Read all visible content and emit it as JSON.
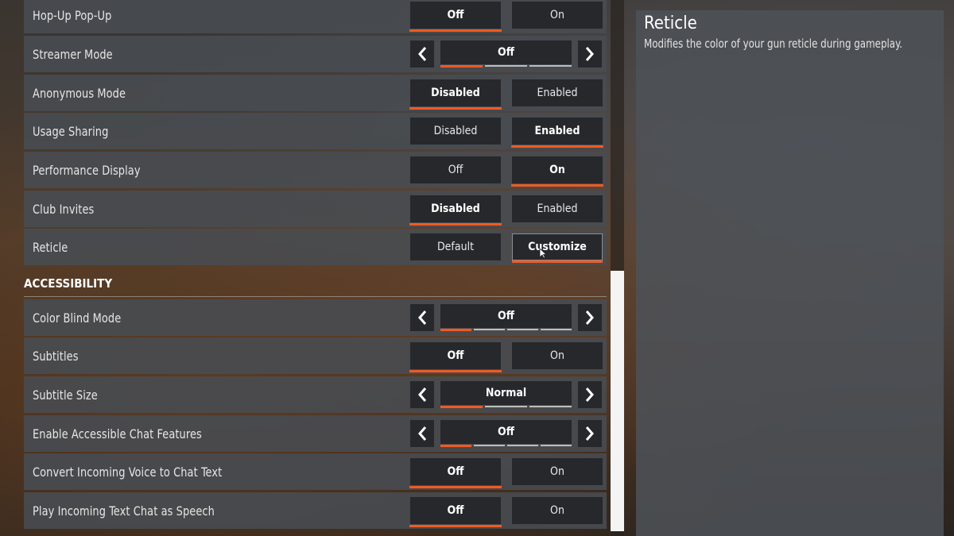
{
  "colors": {
    "accent": "#f05a22",
    "scrollbar": "#f4f4f4"
  },
  "rows_top": [
    {
      "label": "Hop-Up Pop-Up",
      "type": "toggle",
      "options": [
        "Off",
        "On"
      ],
      "selected": 0
    },
    {
      "label": "Streamer Mode",
      "type": "carousel",
      "value": "Off",
      "pips": 3,
      "index": 0
    },
    {
      "label": "Anonymous Mode",
      "type": "toggle",
      "options": [
        "Disabled",
        "Enabled"
      ],
      "selected": 0
    },
    {
      "label": "Usage Sharing",
      "type": "toggle",
      "options": [
        "Disabled",
        "Enabled"
      ],
      "selected": 1
    },
    {
      "label": "Performance Display",
      "type": "toggle",
      "options": [
        "Off",
        "On"
      ],
      "selected": 1
    },
    {
      "label": "Club Invites",
      "type": "toggle",
      "options": [
        "Disabled",
        "Enabled"
      ],
      "selected": 0
    },
    {
      "label": "Reticle",
      "type": "toggle",
      "options": [
        "Default",
        "Customize"
      ],
      "selected": 1,
      "hovered": 1
    }
  ],
  "section": {
    "title": "ACCESSIBILITY"
  },
  "rows_access": [
    {
      "label": "Color Blind Mode",
      "type": "carousel",
      "value": "Off",
      "pips": 4,
      "index": 0
    },
    {
      "label": "Subtitles",
      "type": "toggle",
      "options": [
        "Off",
        "On"
      ],
      "selected": 0
    },
    {
      "label": "Subtitle Size",
      "type": "carousel",
      "value": "Normal",
      "pips": 3,
      "index": 0
    },
    {
      "label": "Enable Accessible Chat Features",
      "type": "carousel",
      "value": "Off",
      "pips": 4,
      "index": 0
    },
    {
      "label": "Convert Incoming Voice to Chat Text",
      "type": "toggle",
      "options": [
        "Off",
        "On"
      ],
      "selected": 0
    },
    {
      "label": "Play Incoming Text Chat as Speech",
      "type": "toggle",
      "options": [
        "Off",
        "On"
      ],
      "selected": 0
    }
  ],
  "description": {
    "title": "Reticle",
    "text": "Modifies the color of your gun reticle during gameplay."
  },
  "scrollbar": {
    "position_fraction": 0.51
  }
}
